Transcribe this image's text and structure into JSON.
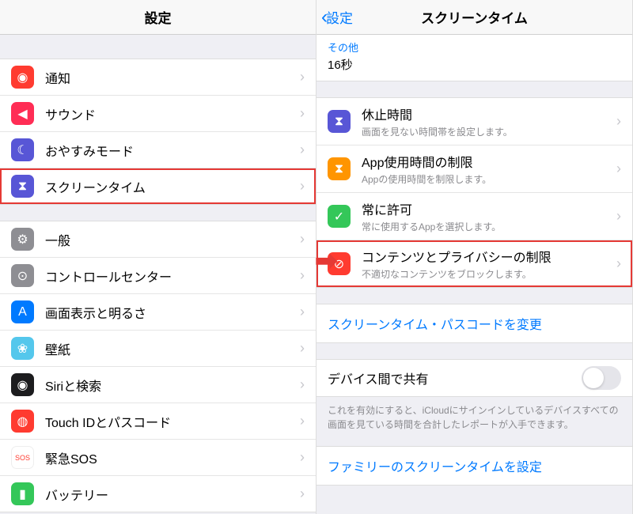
{
  "left": {
    "title": "設定",
    "groups": [
      {
        "items": [
          {
            "id": "notifications",
            "label": "通知",
            "iconClass": "bell",
            "glyph": "◉",
            "highlight": false
          },
          {
            "id": "sounds",
            "label": "サウンド",
            "iconClass": "sound",
            "glyph": "◀",
            "highlight": false
          },
          {
            "id": "dnd",
            "label": "おやすみモード",
            "iconClass": "moon",
            "glyph": "☾",
            "highlight": false
          },
          {
            "id": "screentime",
            "label": "スクリーンタイム",
            "iconClass": "hourglass",
            "glyph": "⧗",
            "highlight": true
          }
        ]
      },
      {
        "items": [
          {
            "id": "general",
            "label": "一般",
            "iconClass": "gear",
            "glyph": "⚙",
            "highlight": false
          },
          {
            "id": "controlcenter",
            "label": "コントロールセンター",
            "iconClass": "cc",
            "glyph": "⊙",
            "highlight": false
          },
          {
            "id": "display",
            "label": "画面表示と明るさ",
            "iconClass": "aa",
            "glyph": "A",
            "highlight": false
          },
          {
            "id": "wallpaper",
            "label": "壁紙",
            "iconClass": "wall",
            "glyph": "❀",
            "highlight": false
          },
          {
            "id": "siri",
            "label": "Siriと検索",
            "iconClass": "siri",
            "glyph": "◉",
            "highlight": false
          },
          {
            "id": "touchid",
            "label": "Touch IDとパスコード",
            "iconClass": "touchid",
            "glyph": "◍",
            "highlight": false
          },
          {
            "id": "sos",
            "label": "緊急SOS",
            "iconClass": "sos",
            "glyph": "SOS",
            "highlight": false
          },
          {
            "id": "battery",
            "label": "バッテリー",
            "iconClass": "battery",
            "glyph": "▮",
            "highlight": false
          }
        ]
      }
    ]
  },
  "right": {
    "back": "設定",
    "title": "スクリーンタイム",
    "info": {
      "label": "その他",
      "value": "16秒"
    },
    "options": [
      {
        "id": "downtime",
        "label": "休止時間",
        "sub": "画面を見ない時間帯を設定します。",
        "iconClass": "downtime",
        "glyph": "⧗",
        "highlight": false
      },
      {
        "id": "applimit",
        "label": "App使用時間の制限",
        "sub": "Appの使用時間を制限します。",
        "iconClass": "applimit",
        "glyph": "⧗",
        "highlight": false
      },
      {
        "id": "always",
        "label": "常に許可",
        "sub": "常に使用するAppを選択します。",
        "iconClass": "always",
        "glyph": "✓",
        "highlight": false
      },
      {
        "id": "restrict",
        "label": "コンテンツとプライバシーの制限",
        "sub": "不適切なコンテンツをブロックします。",
        "iconClass": "restrict",
        "glyph": "⊘",
        "highlight": true
      }
    ],
    "passcode_link": "スクリーンタイム・パスコードを変更",
    "share": {
      "label": "デバイス間で共有",
      "note": "これを有効にすると、iCloudにサインインしているデバイスすべての画面を見ている時間を合計したレポートが入手できます。"
    },
    "family_link": "ファミリーのスクリーンタイムを設定"
  }
}
